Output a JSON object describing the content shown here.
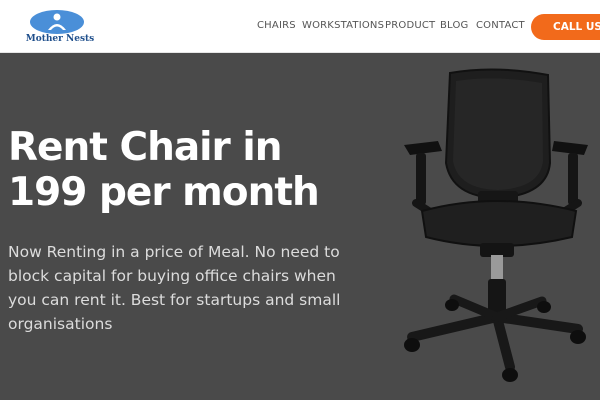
{
  "header": {
    "logo_text": "Mother Nests",
    "nav": [
      "CHAIRS",
      "WORKSTATIONS",
      "PRODUCT",
      "BLOG",
      "CONTACT"
    ],
    "cta_label": "CALL US"
  },
  "hero": {
    "title": "Rent Chair in 199 per month",
    "description": "Now Renting in a price of Meal. No need to block capital for buying office chairs when you can rent it. Best for startups and small organisations"
  },
  "colors": {
    "hero_background": "#4a4a4a",
    "cta": "#f26a1b",
    "logo_badge": "#4a8fd8",
    "logo_text": "#1f4f8c"
  },
  "icons": [
    "logo-badge-icon",
    "office-chair-image"
  ]
}
